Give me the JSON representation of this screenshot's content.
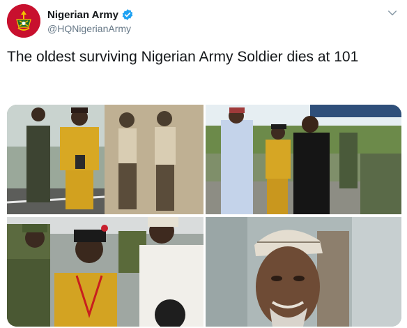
{
  "account": {
    "display_name": "Nigerian Army",
    "handle": "@HQNigerianArmy",
    "verified_icon": "verified-badge-icon",
    "avatar_icon": "army-crest-icon"
  },
  "tweet": {
    "text": "The oldest surviving Nigerian Army Soldier dies at 101"
  },
  "media": {
    "count": 4,
    "photos": [
      {
        "name": "photo-soldier-with-vintage-portrait"
      },
      {
        "name": "photo-handshake-ceremony"
      },
      {
        "name": "photo-soldiers-greeting-veteran"
      },
      {
        "name": "photo-veteran-portrait"
      }
    ]
  },
  "colors": {
    "brand_red": "#c8102e",
    "verified_blue": "#1da1f2",
    "text_primary": "#14171a",
    "text_secondary": "#657786"
  }
}
